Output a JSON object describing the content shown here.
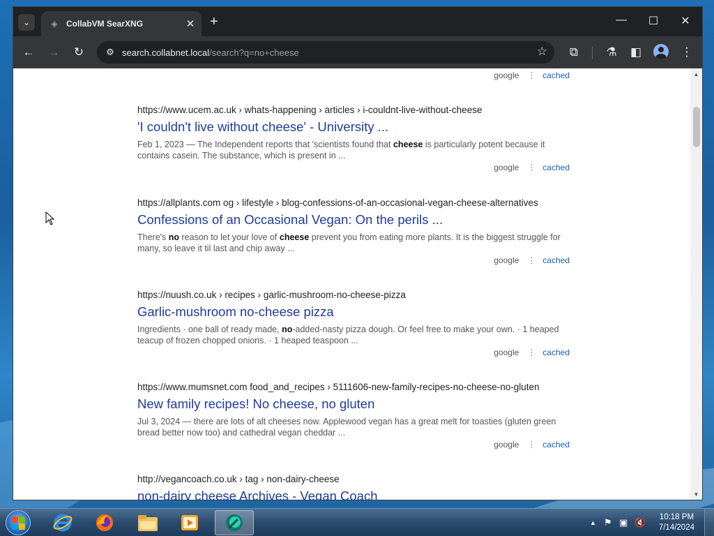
{
  "browser": {
    "tab_title": "CollabVM SearXNG",
    "tab_close": "✕",
    "new_tab": "+",
    "url_host": "search.collabnet.local",
    "url_path": "/search?q=no+cheese"
  },
  "top_actions": {
    "google": "google",
    "cached": "cached"
  },
  "results": [
    {
      "url": "https://www.ucem.ac.uk  › whats-happening › articles › i-couldnt-live-without-cheese",
      "title": "'I couldn't live without cheese' - University ...",
      "snippet_html": "Feb 1, 2023 — The Independent reports that 'scientists found that <b>cheese</b> is particularly potent because it contains casein. The substance, which is present in ...",
      "google": "google",
      "cached": "cached"
    },
    {
      "url": "https://allplants.com  og › lifestyle › blog-confessions-of-an-occasional-vegan-cheese-alternatives",
      "title": "Confessions of an Occasional Vegan: On the perils ...",
      "snippet_html": "There's <b>no</b> reason to let your love of <b>cheese</b> prevent you from eating more plants. It is the biggest struggle for many, so leave it til last and chip away ...",
      "google": "google",
      "cached": "cached"
    },
    {
      "url": "https://nuush.co.uk  › recipes › garlic-mushroom-no-cheese-pizza",
      "title": "Garlic-mushroom no-cheese pizza",
      "snippet_html": "Ingredients · one ball of ready made, <b>no</b>-added-nasty pizza dough. Or feel free to make your own. · 1 heaped teacup of frozen chopped onions. · 1 heaped teaspoon ...",
      "google": "google",
      "cached": "cached"
    },
    {
      "url": "https://www.mumsnet.com  food_and_recipes › 5111606-new-family-recipes-no-cheese-no-gluten",
      "title": "New family recipes! No cheese, no gluten",
      "snippet_html": "Jul 3, 2024 — there are lots of alt cheeses now. Applewood vegan has a great melt for toasties (gluten green bread better now too) and cathedral vegan cheddar ...",
      "google": "google",
      "cached": "cached"
    },
    {
      "url": "http://vegancoach.co.uk  › tag › non-dairy-cheese",
      "title": "non-dairy cheese Archives - Vegan Coach",
      "snippet_html": "",
      "google": "",
      "cached": ""
    }
  ],
  "taskbar": {
    "time": "10:18 PM",
    "date": "7/14/2024"
  },
  "colors": {
    "link": "#1f3b9c",
    "cached": "#1a5fb4",
    "chrome_dark": "#202124",
    "chrome_toolbar": "#35363a"
  }
}
